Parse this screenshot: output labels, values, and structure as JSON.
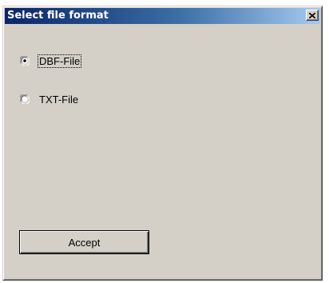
{
  "window": {
    "title": "Select file format",
    "close_icon": "close-icon"
  },
  "format_options": [
    {
      "label": "DBF-File",
      "selected": true,
      "focused": true
    },
    {
      "label": "TXT-File",
      "selected": false,
      "focused": false
    }
  ],
  "buttons": {
    "accept_label": "Accept"
  },
  "colors": {
    "face": "#d4d0c8",
    "title_start": "#0a246a",
    "title_end": "#a6caf0"
  }
}
